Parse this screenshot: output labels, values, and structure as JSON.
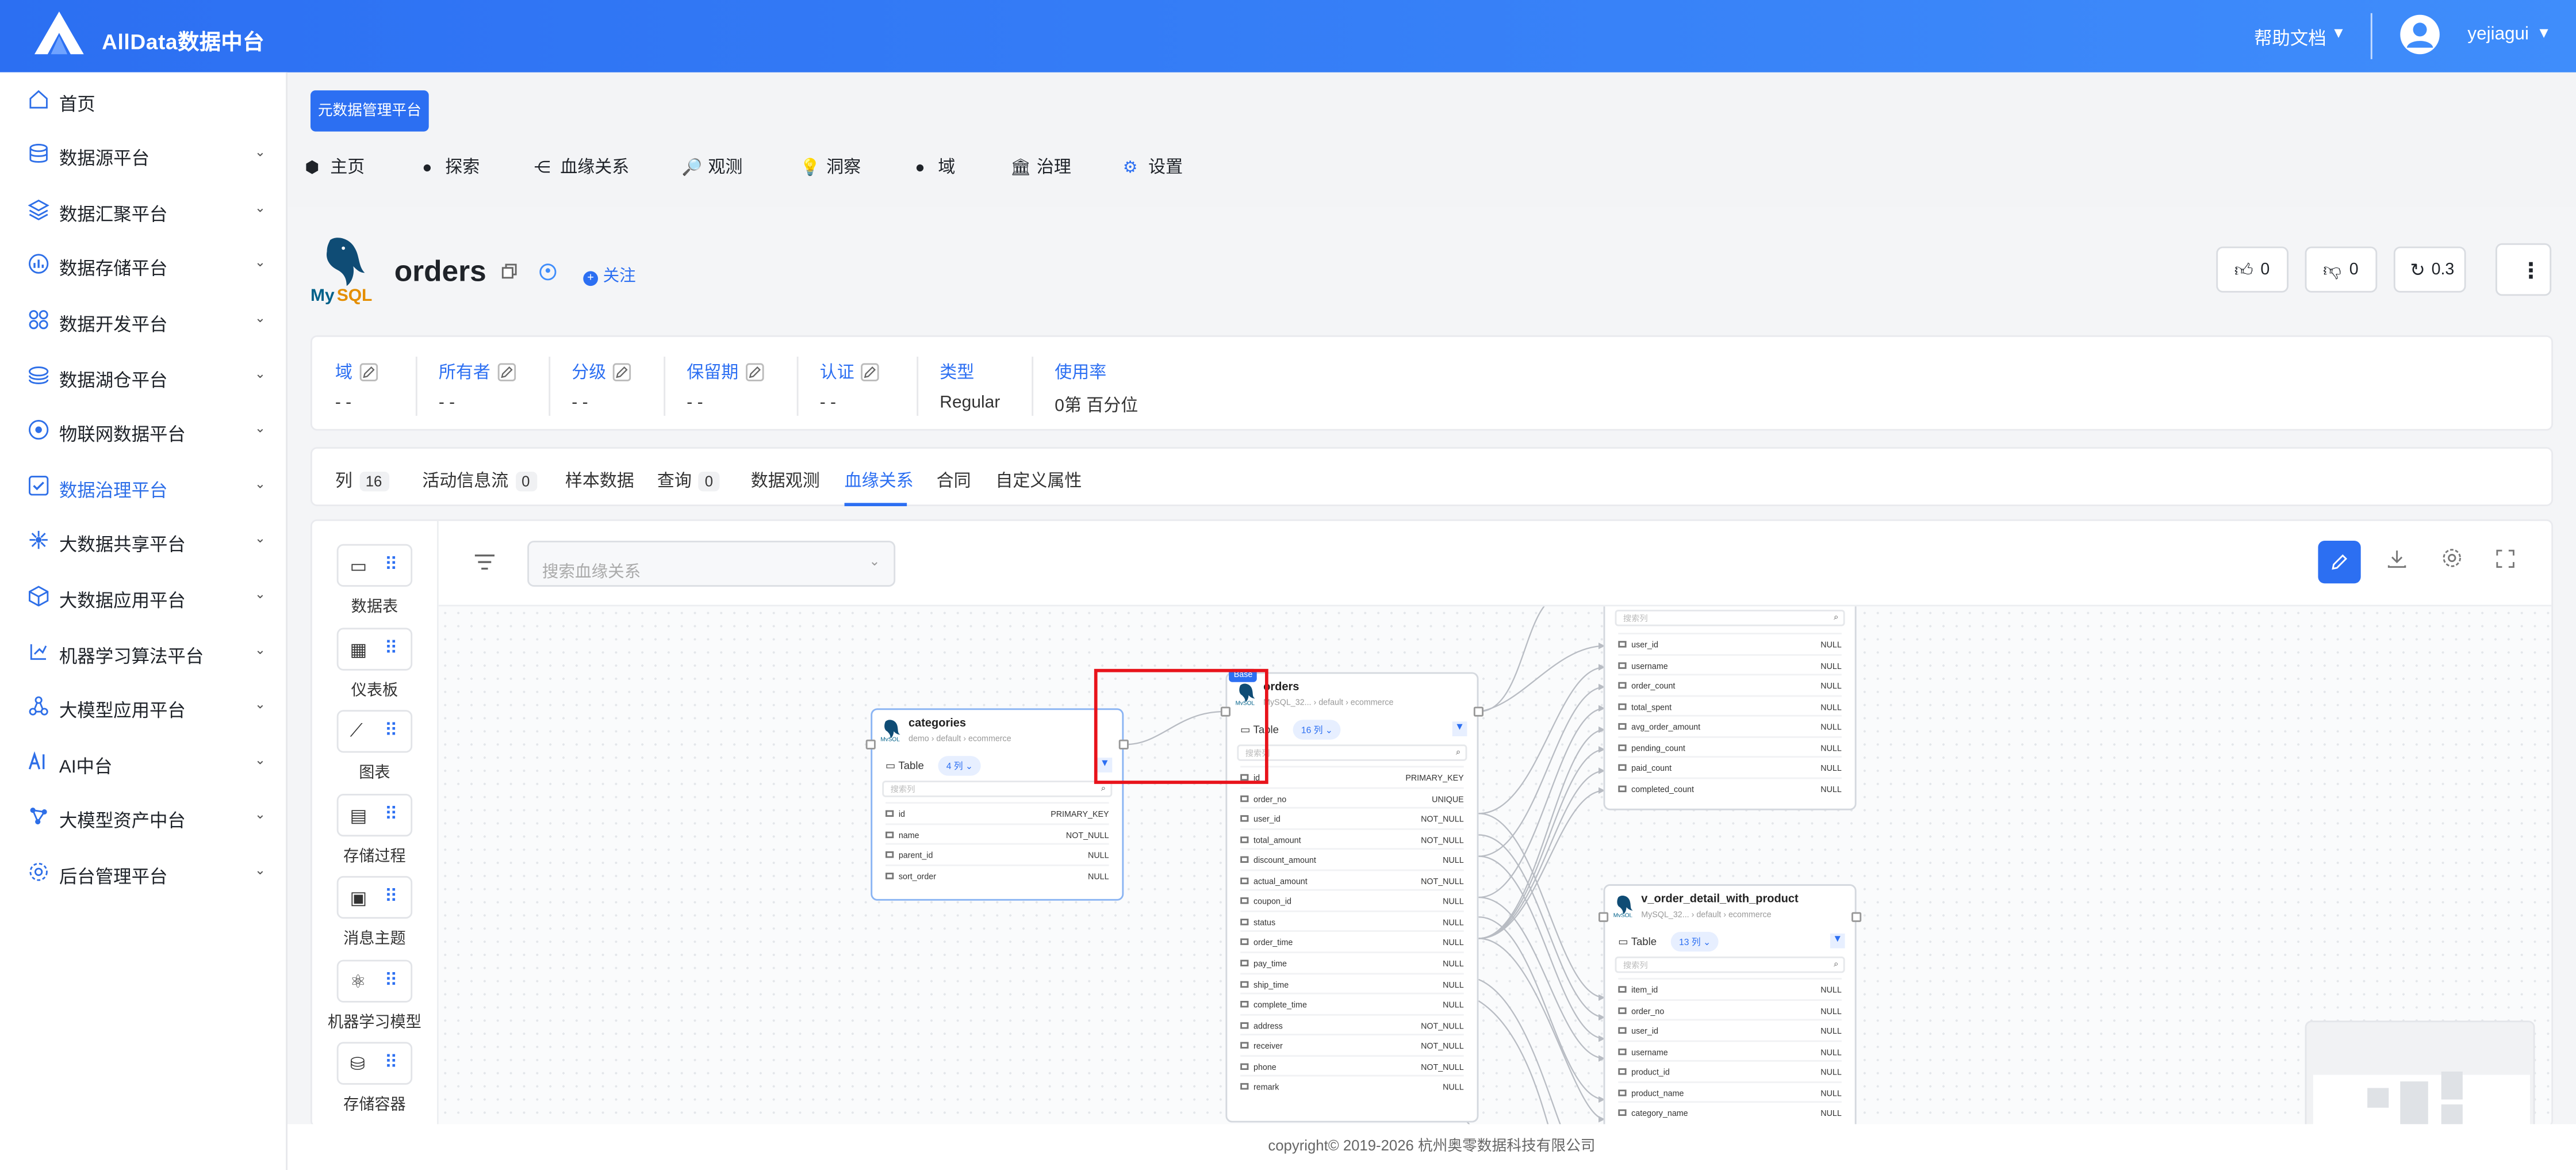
{
  "header": {
    "title": "AllData数据中台",
    "help": "帮助文档",
    "caret": "▼",
    "user": "yejiagui"
  },
  "sidebar": {
    "items": [
      {
        "label": "首页",
        "icon": "home-icon",
        "chevron": ""
      },
      {
        "label": "数据源平台",
        "icon": "database-icon",
        "chevron": "⌄"
      },
      {
        "label": "数据汇聚平台",
        "icon": "layers-icon",
        "chevron": "⌄"
      },
      {
        "label": "数据存储平台",
        "icon": "bar-chart-icon",
        "chevron": "⌄"
      },
      {
        "label": "数据开发平台",
        "icon": "grid-dots-icon",
        "chevron": "⌄"
      },
      {
        "label": "数据湖仓平台",
        "icon": "stack-icon",
        "chevron": "⌄"
      },
      {
        "label": "物联网数据平台",
        "icon": "network-icon",
        "chevron": "⌄"
      },
      {
        "label": "数据治理平台",
        "icon": "checkbox-icon",
        "chevron": "⌄"
      },
      {
        "label": "大数据共享平台",
        "icon": "share-icon",
        "chevron": "⌄"
      },
      {
        "label": "大数据应用平台",
        "icon": "cube-icon",
        "chevron": "⌄"
      },
      {
        "label": "机器学习算法平台",
        "icon": "ml-icon",
        "chevron": "⌄"
      },
      {
        "label": "大模型应用平台",
        "icon": "nodes-icon",
        "chevron": "⌄"
      },
      {
        "label": "AI中台",
        "icon": "ai-icon",
        "chevron": "⌄"
      },
      {
        "label": "大模型资产中台",
        "icon": "graph-icon",
        "chevron": "⌄"
      },
      {
        "label": "后台管理平台",
        "icon": "gear-icon",
        "chevron": "⌄"
      }
    ],
    "active_index": 7,
    "active_color": "#2e6fe8"
  },
  "meta_button": "元数据管理平台",
  "nav": {
    "items": [
      {
        "label": "主页",
        "icon": "⬢"
      },
      {
        "label": "探索",
        "icon": "●"
      },
      {
        "label": "血缘关系",
        "icon": "⋲"
      },
      {
        "label": "观测",
        "icon": "🔎"
      },
      {
        "label": "洞察",
        "icon": "💡"
      },
      {
        "label": "域",
        "icon": "●"
      },
      {
        "label": "治理",
        "icon": "🏛"
      },
      {
        "label": "设置",
        "icon": "⚙"
      }
    ]
  },
  "entity": {
    "name": "orders",
    "logo_text": "MySQL",
    "follow": "关注",
    "likes": "0",
    "dislikes": "0",
    "version": "0.3",
    "more": "⋮"
  },
  "info": {
    "columns": [
      {
        "label": "域",
        "value": "- -",
        "editable": true
      },
      {
        "label": "所有者",
        "value": "- -",
        "editable": true
      },
      {
        "label": "分级",
        "value": "- -",
        "editable": true
      },
      {
        "label": "保留期",
        "value": "- -",
        "editable": true
      },
      {
        "label": "认证",
        "value": "- -",
        "editable": true
      },
      {
        "label": "类型",
        "value": "Regular",
        "editable": false
      },
      {
        "label": "使用率",
        "value": "0第 百分位",
        "editable": false
      }
    ]
  },
  "tabs": [
    {
      "label": "列",
      "count": "16"
    },
    {
      "label": "活动信息流",
      "count": "0"
    },
    {
      "label": "样本数据",
      "count": ""
    },
    {
      "label": "查询",
      "count": "0"
    },
    {
      "label": "数据观测",
      "count": ""
    },
    {
      "label": "血缘关系",
      "count": "",
      "active": true
    },
    {
      "label": "合同",
      "count": ""
    },
    {
      "label": "自定义属性",
      "count": ""
    }
  ],
  "palette": [
    {
      "label": "数据表",
      "icon": "table-icon",
      "glyph": "▭"
    },
    {
      "label": "仪表板",
      "icon": "dashboard-icon",
      "glyph": "▦"
    },
    {
      "label": "图表",
      "icon": "line-chart-icon",
      "glyph": "⟋"
    },
    {
      "label": "存储过程",
      "icon": "procedure-icon",
      "glyph": "▤"
    },
    {
      "label": "消息主题",
      "icon": "topic-icon",
      "glyph": "▣"
    },
    {
      "label": "机器学习模型",
      "icon": "ml-model-icon",
      "glyph": "⚛"
    },
    {
      "label": "存储容器",
      "icon": "container-icon",
      "glyph": "⛁"
    }
  ],
  "lineage": {
    "search_placeholder": "搜索血缘关系",
    "base_badge": "Base",
    "column_search_placeholder": "搜索列",
    "nodes": {
      "categories": {
        "title": "categories",
        "sub": "demo › default › ecommerce",
        "type": "Table",
        "cols": "4 列",
        "rows": [
          {
            "name": "id",
            "constraint": "PRIMARY_KEY"
          },
          {
            "name": "name",
            "constraint": "NOT_NULL"
          },
          {
            "name": "parent_id",
            "constraint": "NULL"
          },
          {
            "name": "sort_order",
            "constraint": "NULL"
          }
        ]
      },
      "orders": {
        "title": "orders",
        "sub": "MySQL_32... › default › ecommerce",
        "type": "Table",
        "cols": "16 列",
        "rows": [
          {
            "name": "id",
            "constraint": "PRIMARY_KEY"
          },
          {
            "name": "order_no",
            "constraint": "UNIQUE"
          },
          {
            "name": "user_id",
            "constraint": "NOT_NULL"
          },
          {
            "name": "total_amount",
            "constraint": "NOT_NULL"
          },
          {
            "name": "discount_amount",
            "constraint": "NULL"
          },
          {
            "name": "actual_amount",
            "constraint": "NOT_NULL"
          },
          {
            "name": "coupon_id",
            "constraint": "NULL"
          },
          {
            "name": "status",
            "constraint": "NULL"
          },
          {
            "name": "order_time",
            "constraint": "NULL"
          },
          {
            "name": "pay_time",
            "constraint": "NULL"
          },
          {
            "name": "ship_time",
            "constraint": "NULL"
          },
          {
            "name": "complete_time",
            "constraint": "NULL"
          },
          {
            "name": "address",
            "constraint": "NOT_NULL"
          },
          {
            "name": "receiver",
            "constraint": "NOT_NULL"
          },
          {
            "name": "phone",
            "constraint": "NOT_NULL"
          },
          {
            "name": "remark",
            "constraint": "NULL"
          }
        ]
      },
      "user_summary": {
        "rows": [
          {
            "name": "user_id",
            "constraint": "NULL"
          },
          {
            "name": "username",
            "constraint": "NULL"
          },
          {
            "name": "order_count",
            "constraint": "NULL"
          },
          {
            "name": "total_spent",
            "constraint": "NULL"
          },
          {
            "name": "avg_order_amount",
            "constraint": "NULL"
          },
          {
            "name": "pending_count",
            "constraint": "NULL"
          },
          {
            "name": "paid_count",
            "constraint": "NULL"
          },
          {
            "name": "completed_count",
            "constraint": "NULL"
          }
        ]
      },
      "v_order_detail": {
        "title": "v_order_detail_with_product",
        "sub": "MySQL_32... › default › ecommerce",
        "type": "Table",
        "cols": "13 列",
        "rows": [
          {
            "name": "item_id",
            "constraint": "NULL"
          },
          {
            "name": "order_no",
            "constraint": "NULL"
          },
          {
            "name": "user_id",
            "constraint": "NULL"
          },
          {
            "name": "username",
            "constraint": "NULL"
          },
          {
            "name": "product_id",
            "constraint": "NULL"
          },
          {
            "name": "product_name",
            "constraint": "NULL"
          },
          {
            "name": "category_name",
            "constraint": "NULL"
          }
        ]
      }
    }
  },
  "footer": "copyright© 2019-2026 杭州奥零数据科技有限公司",
  "colors": {
    "brand": "#2c6ff2",
    "highlight": "#e8131b"
  }
}
